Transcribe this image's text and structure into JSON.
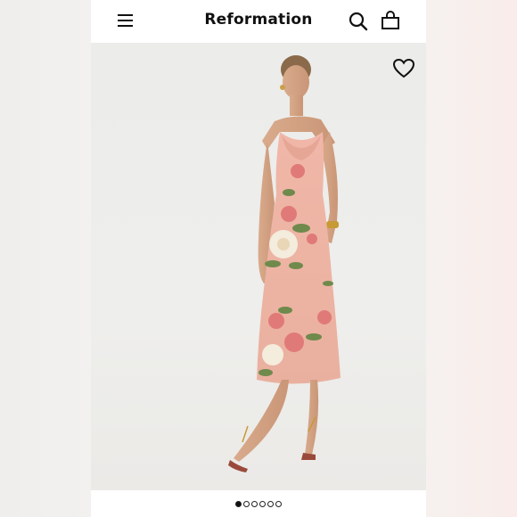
{
  "header": {
    "brand": "Reformation",
    "menu_icon": "hamburger-menu-icon",
    "search_icon": "search-icon",
    "bag_icon": "shopping-bag-icon"
  },
  "product_image": {
    "favorite_icon": "heart-outline-icon",
    "carousel": {
      "total": 6,
      "active_index": 0
    }
  },
  "colors": {
    "dress_base": "#f2b3a4",
    "rose": "#e07a78",
    "leaf": "#6f8a4c",
    "cream_flower": "#f4ecdc"
  }
}
